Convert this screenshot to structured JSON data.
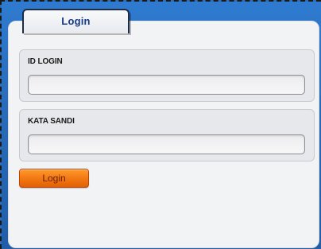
{
  "tab": {
    "label": "Login"
  },
  "login_id": {
    "label": "ID LOGIN",
    "value": "",
    "placeholder": ""
  },
  "password": {
    "label": "KATA SANDI",
    "value": "",
    "placeholder": ""
  },
  "submit": {
    "label": "Login"
  },
  "colors": {
    "background_blue": "#2a6ebd",
    "panel": "#f2f3f5",
    "tab_text": "#173c86",
    "button_orange": "#f47c16"
  }
}
